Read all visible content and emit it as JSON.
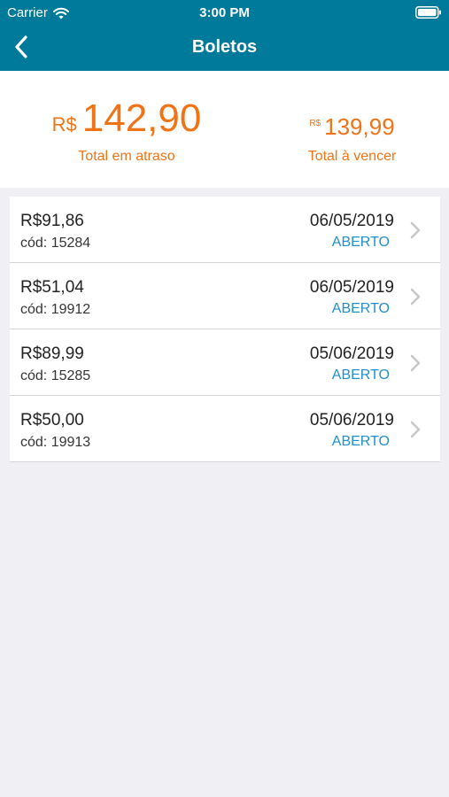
{
  "status_bar": {
    "carrier": "Carrier",
    "time": "3:00 PM"
  },
  "nav": {
    "title": "Boletos",
    "back_icon": "chevron-left-icon"
  },
  "summary": {
    "overdue": {
      "currency": "R$",
      "amount": "142,90",
      "label": "Total em atraso"
    },
    "upcoming": {
      "currency": "R$",
      "amount": "139,99",
      "label": "Total à vencer"
    }
  },
  "colors": {
    "header": "#007a9a",
    "accent": "#f07316",
    "status": "#1f8fce",
    "background": "#efeff4"
  },
  "boletos": [
    {
      "value": "R$91,86",
      "code": "cód: 15284",
      "date": "06/05/2019",
      "status": "ABERTO"
    },
    {
      "value": "R$51,04",
      "code": "cód: 19912",
      "date": "06/05/2019",
      "status": "ABERTO"
    },
    {
      "value": "R$89,99",
      "code": "cód: 15285",
      "date": "05/06/2019",
      "status": "ABERTO"
    },
    {
      "value": "R$50,00",
      "code": "cód: 19913",
      "date": "05/06/2019",
      "status": "ABERTO"
    }
  ]
}
